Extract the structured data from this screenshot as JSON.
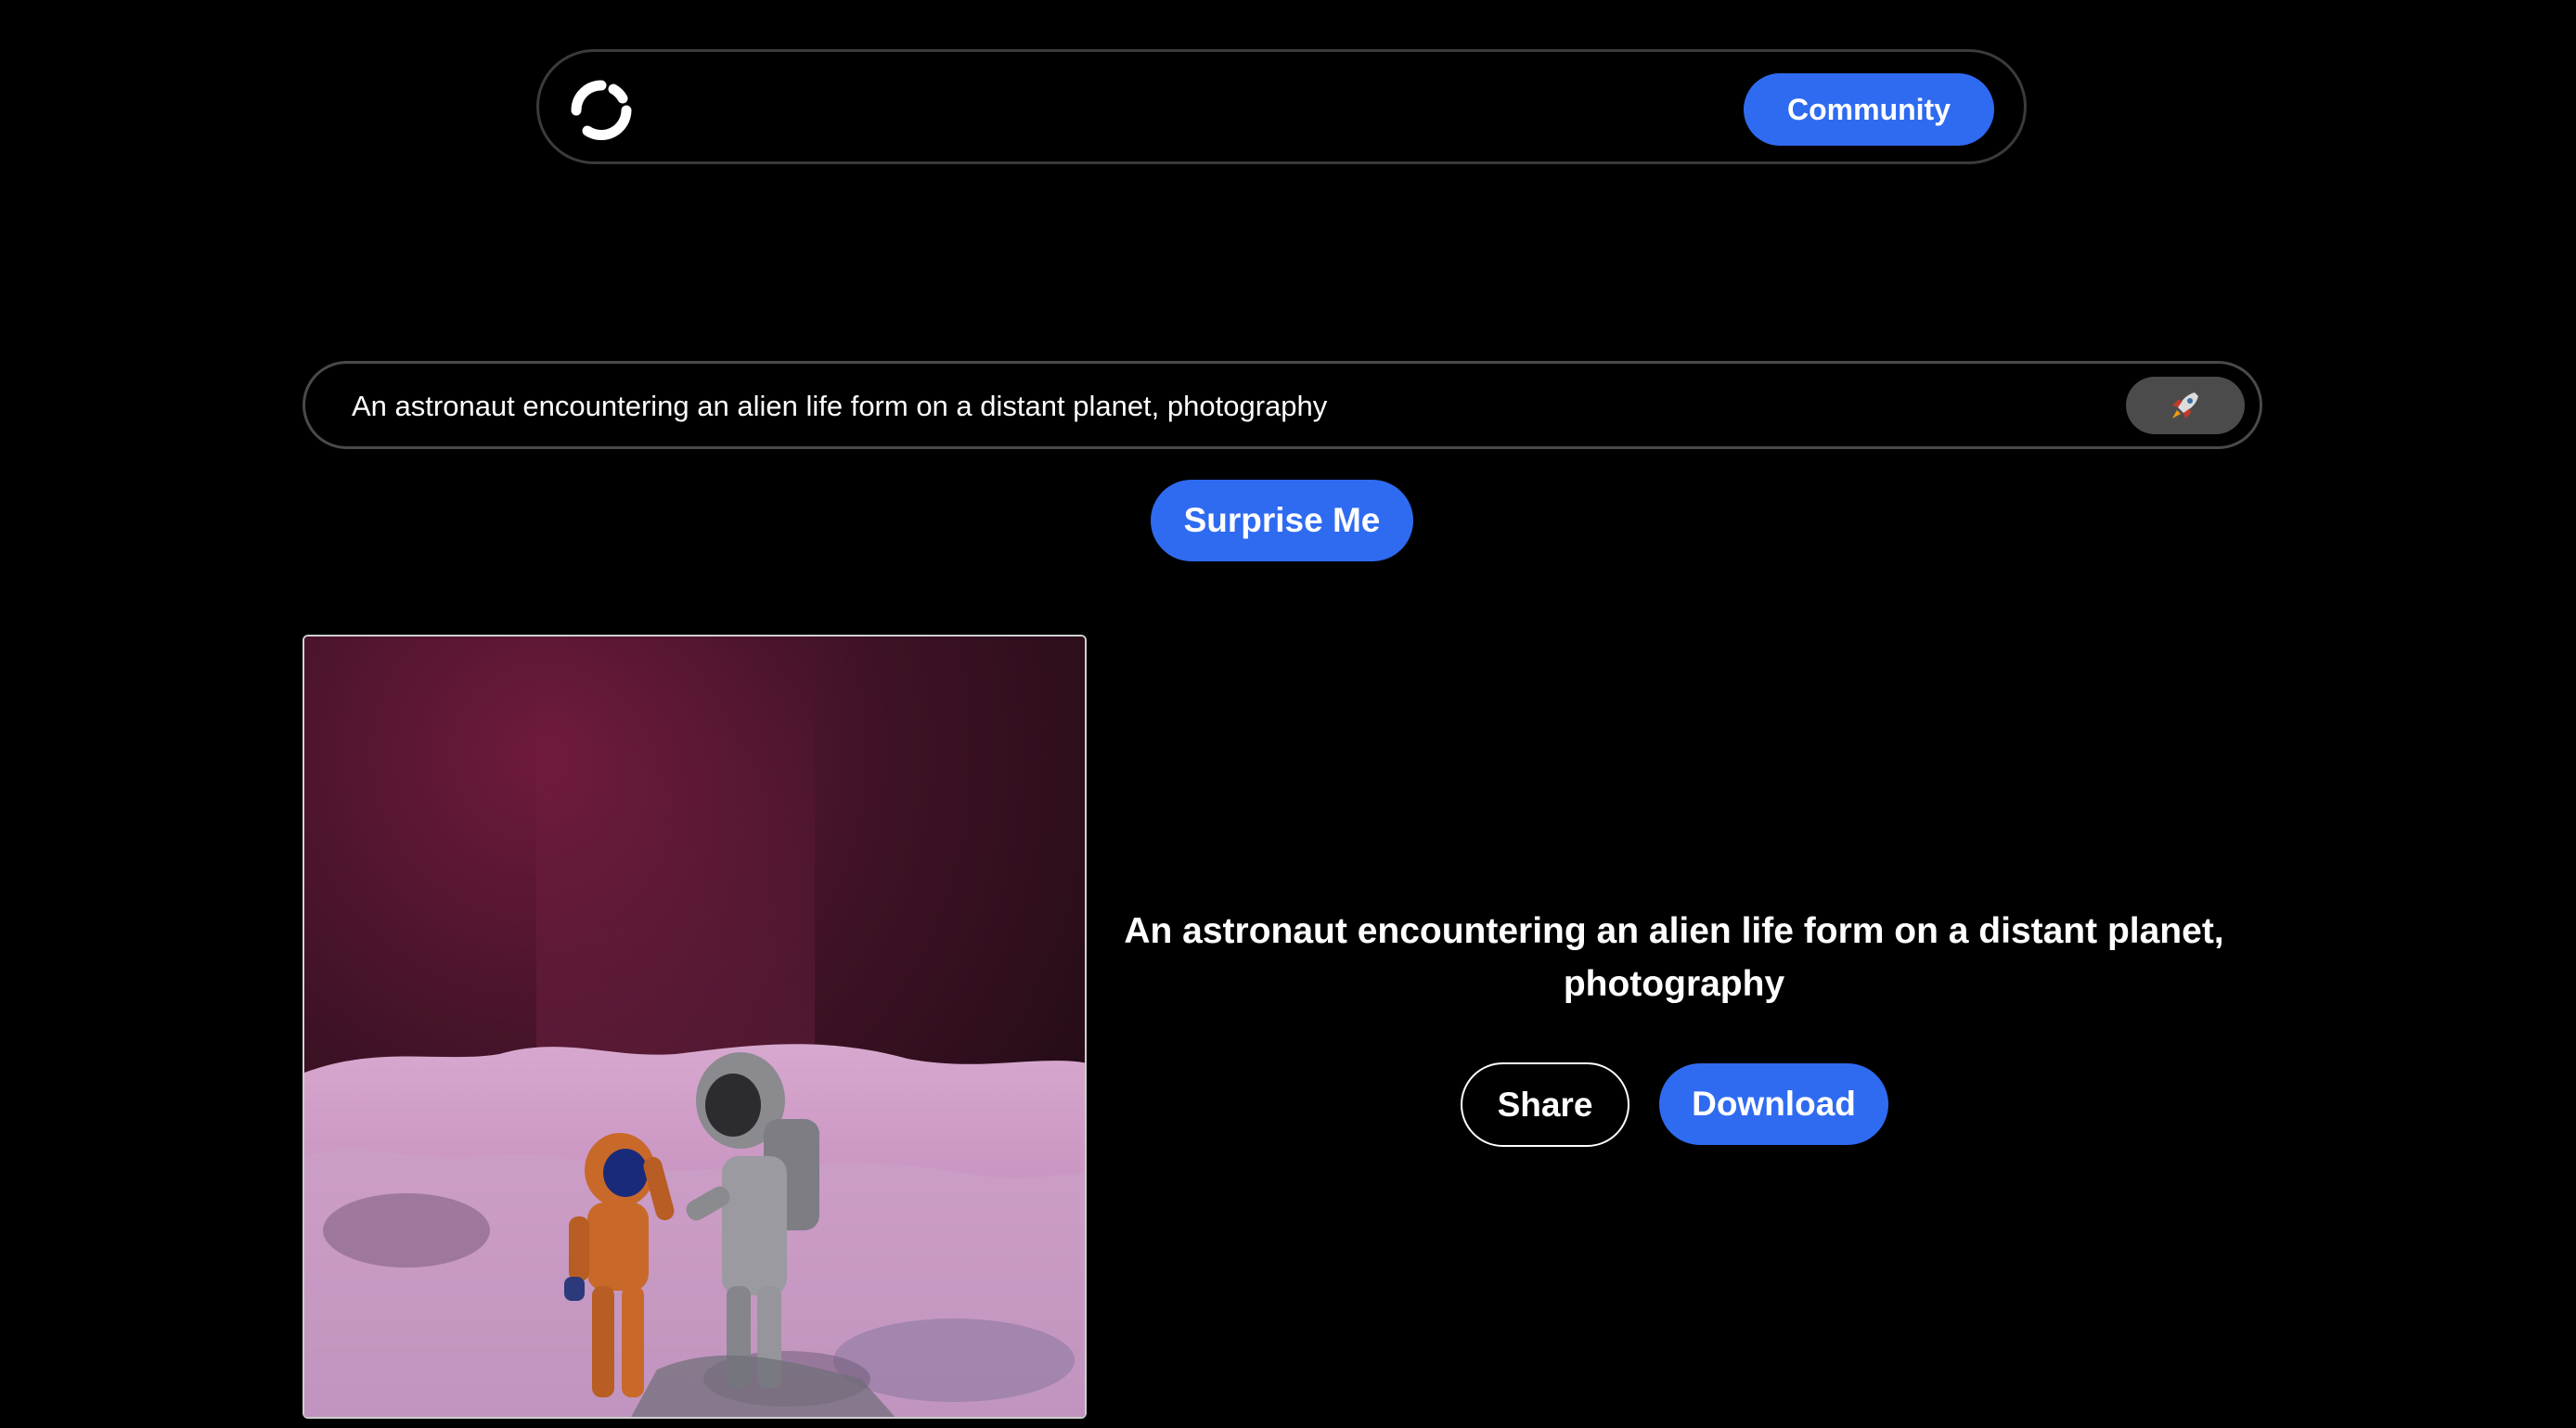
{
  "nav": {
    "logo_icon": "circular-arrows-logo-icon",
    "community_label": "Community"
  },
  "prompt": {
    "value": "An astronaut encountering an alien life form on a distant planet, photography",
    "send_icon": "rocket-icon"
  },
  "actions": {
    "surprise_label": "Surprise Me",
    "share_label": "Share",
    "download_label": "Download"
  },
  "result": {
    "caption": "An astronaut encountering an alien life form on a distant planet, photography"
  },
  "colors": {
    "background": "#000000",
    "accent": "#2f6bf1",
    "border": "#3b3b3b",
    "send_button_bg": "#4b4b4b"
  }
}
